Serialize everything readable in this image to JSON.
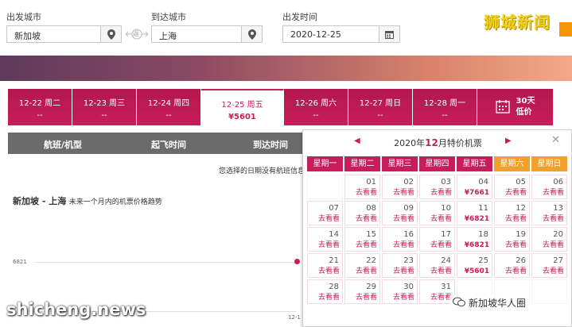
{
  "search": {
    "from_label": "出发城市",
    "from_value": "新加坡",
    "to_label": "到达城市",
    "to_value": "上海",
    "date_label": "出发时间",
    "date_value": "2020-12-25",
    "swap_text": "返"
  },
  "brand": {
    "text": "狮城新闻"
  },
  "tabs": [
    {
      "date": "12-22  周二",
      "price": "--"
    },
    {
      "date": "12-23  周三",
      "price": "--"
    },
    {
      "date": "12-24  周四",
      "price": "--"
    },
    {
      "date": "12-25  周五",
      "price": "¥5601"
    },
    {
      "date": "12-26  周六",
      "price": "--"
    },
    {
      "date": "12-27  周日",
      "price": "--"
    },
    {
      "date": "12-28  周一",
      "price": "--"
    }
  ],
  "low_tab": {
    "line1": "30天",
    "line2": "低价"
  },
  "table_header": {
    "col1": "航班/机型",
    "col2": "起飞时间",
    "col3": "到达时间"
  },
  "notice": "您选择的日期没有航班信息",
  "trend": {
    "route": "新加坡 - 上海",
    "desc": "未来一个月内的机票价格趋势",
    "ytick": "6821",
    "xtick": "12-1"
  },
  "watermark_left": "shicheng.news",
  "watermark_right": "新加坡华人圈",
  "calendar": {
    "year_prefix": "2020年",
    "month": "12",
    "title_suffix": "月特价机票",
    "weekdays": [
      "星期一",
      "星期二",
      "星期三",
      "星期四",
      "星期五",
      "星期六",
      "星期日"
    ],
    "weeks": [
      [
        null,
        {
          "d": "01",
          "t": "去看看"
        },
        {
          "d": "02",
          "t": "去看看"
        },
        {
          "d": "03",
          "t": "去看看"
        },
        {
          "d": "04",
          "t": "¥7661"
        },
        {
          "d": "05",
          "t": "去看看"
        },
        {
          "d": "06",
          "t": "去看看"
        }
      ],
      [
        {
          "d": "07",
          "t": "去看看"
        },
        {
          "d": "08",
          "t": "去看看"
        },
        {
          "d": "09",
          "t": "去看看"
        },
        {
          "d": "10",
          "t": "去看看"
        },
        {
          "d": "11",
          "t": "¥6821"
        },
        {
          "d": "12",
          "t": "去看看"
        },
        {
          "d": "13",
          "t": "去看看"
        }
      ],
      [
        {
          "d": "14",
          "t": "去看看"
        },
        {
          "d": "15",
          "t": "去看看"
        },
        {
          "d": "16",
          "t": "去看看"
        },
        {
          "d": "17",
          "t": "去看看"
        },
        {
          "d": "18",
          "t": "¥6821"
        },
        {
          "d": "19",
          "t": "去看看"
        },
        {
          "d": "20",
          "t": "去看看"
        }
      ],
      [
        {
          "d": "21",
          "t": "去看看"
        },
        {
          "d": "22",
          "t": "去看看"
        },
        {
          "d": "23",
          "t": "去看看"
        },
        {
          "d": "24",
          "t": "去看看"
        },
        {
          "d": "25",
          "t": "¥5601"
        },
        {
          "d": "26",
          "t": "去看看"
        },
        {
          "d": "27",
          "t": "去看看"
        }
      ],
      [
        {
          "d": "28",
          "t": "去看看"
        },
        {
          "d": "29",
          "t": "去看看"
        },
        {
          "d": "30",
          "t": "去看看"
        },
        {
          "d": "31",
          "t": "去看看"
        },
        null,
        null,
        null
      ]
    ]
  }
}
